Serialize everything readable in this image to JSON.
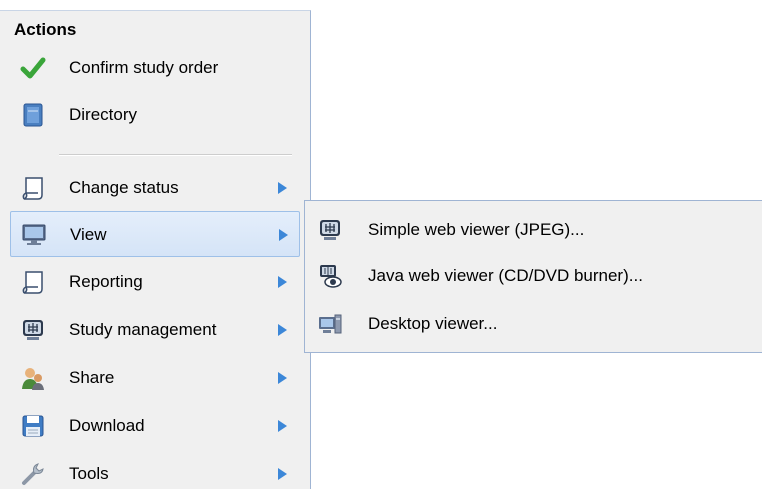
{
  "menu": {
    "title": "Actions",
    "items": [
      {
        "label": "Confirm study order",
        "icon": "checkmark-icon",
        "submenu": false
      },
      {
        "label": "Directory",
        "icon": "book-icon",
        "submenu": false
      },
      {
        "label": "Change status",
        "icon": "scroll-icon",
        "submenu": true
      },
      {
        "label": "View",
        "icon": "monitor-icon",
        "submenu": true,
        "active": true
      },
      {
        "label": "Reporting",
        "icon": "scroll-icon",
        "submenu": true
      },
      {
        "label": "Study management",
        "icon": "xray-icon",
        "submenu": true
      },
      {
        "label": "Share",
        "icon": "users-icon",
        "submenu": true
      },
      {
        "label": "Download",
        "icon": "floppy-disk-icon",
        "submenu": true
      },
      {
        "label": "Tools",
        "icon": "wrench-icon",
        "submenu": true
      }
    ]
  },
  "submenu": {
    "items": [
      {
        "label": "Simple web viewer (JPEG)...",
        "icon": "xray-icon"
      },
      {
        "label": "Java web viewer (CD/DVD burner)...",
        "icon": "eye-viewer-icon"
      },
      {
        "label": "Desktop viewer...",
        "icon": "desktop-icon"
      }
    ]
  },
  "colors": {
    "accent": "#3c87d8",
    "check": "#3aa53a",
    "highlight": "#d5e4f7"
  }
}
